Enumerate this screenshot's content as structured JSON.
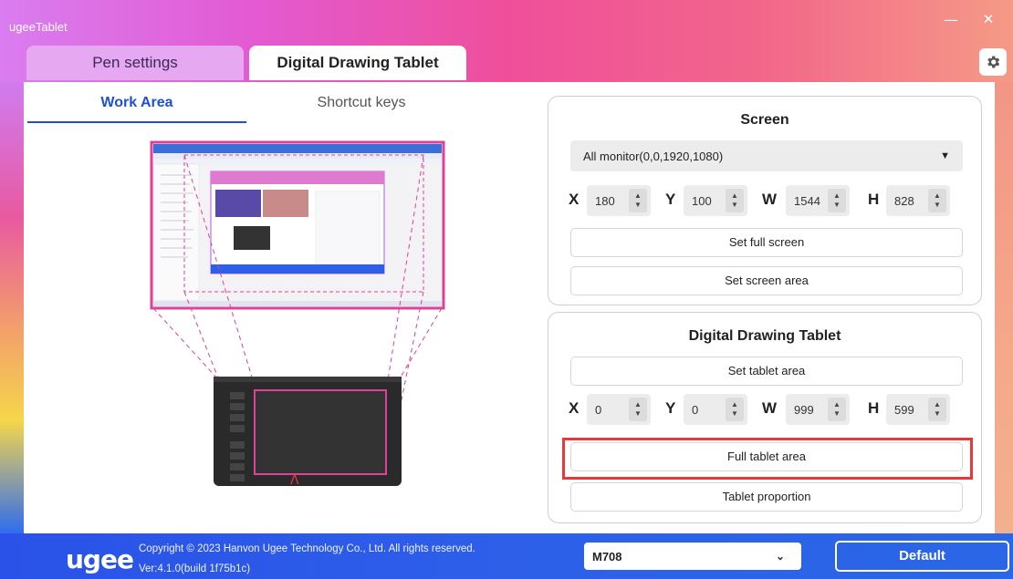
{
  "window": {
    "title": "ugeeTablet",
    "minimize_label": "—",
    "close_label": "✕"
  },
  "top_tabs": {
    "pen": "Pen settings",
    "ddt": "Digital Drawing Tablet",
    "active": "ddt"
  },
  "settings_icon": "gear-icon",
  "sub_tabs": {
    "work_area": "Work Area",
    "shortcut_keys": "Shortcut keys",
    "active": "work_area"
  },
  "screen_panel": {
    "title": "Screen",
    "monitor_select": "All monitor(0,0,1920,1080)",
    "x_label": "X",
    "x_value": "180",
    "y_label": "Y",
    "y_value": "100",
    "w_label": "W",
    "w_value": "1544",
    "h_label": "H",
    "h_value": "828",
    "set_full_screen": "Set full screen",
    "set_screen_area": "Set screen area"
  },
  "tablet_panel": {
    "title": "Digital Drawing Tablet",
    "set_tablet_area": "Set tablet area",
    "x_label": "X",
    "x_value": "0",
    "y_label": "Y",
    "y_value": "0",
    "w_label": "W",
    "w_value": "999",
    "h_label": "H",
    "h_value": "599",
    "full_tablet_area": "Full tablet area",
    "tablet_proportion": "Tablet proportion"
  },
  "footer": {
    "logo": "ugee",
    "copyright": "Copyright © 2023 Hanvon Ugee Technology Co., Ltd. All rights reserved.",
    "version": "Ver:4.1.0(build 1f75b1c)",
    "model": "M708",
    "default_button": "Default"
  },
  "colors": {
    "accent_blue": "#1f4fd6",
    "footer_blue": "#2d5fe9",
    "highlight_red": "#e53a3a",
    "mapping_pink": "#e0409a"
  }
}
